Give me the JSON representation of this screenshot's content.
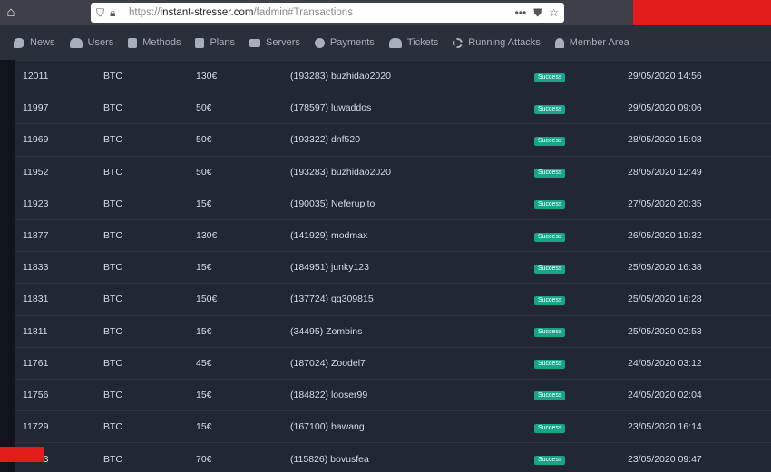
{
  "browser": {
    "url_prefix": "https://",
    "url_host": "instant-stresser.com",
    "url_path": "/fadmin#Transactions"
  },
  "nav": [
    {
      "label": "News",
      "icon": "speech-bubble-icon"
    },
    {
      "label": "Users",
      "icon": "users-icon"
    },
    {
      "label": "Methods",
      "icon": "book-icon"
    },
    {
      "label": "Plans",
      "icon": "book-icon"
    },
    {
      "label": "Servers",
      "icon": "server-list-icon"
    },
    {
      "label": "Payments",
      "icon": "coins-icon"
    },
    {
      "label": "Tickets",
      "icon": "users-icon"
    },
    {
      "label": "Running Attacks",
      "icon": "spinner-icon"
    },
    {
      "label": "Member Area",
      "icon": "person-icon"
    }
  ],
  "transactions": {
    "rows": [
      {
        "id": "12011",
        "currency": "BTC",
        "amount": "130€",
        "user": "(193283) buzhidao2020",
        "status": "Success",
        "date": "29/05/2020 14:56"
      },
      {
        "id": "11997",
        "currency": "BTC",
        "amount": "50€",
        "user": "(178597) luwaddos",
        "status": "Success",
        "date": "29/05/2020 09:06"
      },
      {
        "id": "11969",
        "currency": "BTC",
        "amount": "50€",
        "user": "(193322) dnf520",
        "status": "Success",
        "date": "28/05/2020 15:08"
      },
      {
        "id": "11952",
        "currency": "BTC",
        "amount": "50€",
        "user": "(193283) buzhidao2020",
        "status": "Success",
        "date": "28/05/2020 12:49"
      },
      {
        "id": "11923",
        "currency": "BTC",
        "amount": "15€",
        "user": "(190035) Neferupito",
        "status": "Success",
        "date": "27/05/2020 20:35"
      },
      {
        "id": "11877",
        "currency": "BTC",
        "amount": "130€",
        "user": "(141929) modmax",
        "status": "Success",
        "date": "26/05/2020 19:32"
      },
      {
        "id": "11833",
        "currency": "BTC",
        "amount": "15€",
        "user": "(184951) junky123",
        "status": "Success",
        "date": "25/05/2020 16:38"
      },
      {
        "id": "11831",
        "currency": "BTC",
        "amount": "150€",
        "user": "(137724) qq309815",
        "status": "Success",
        "date": "25/05/2020 16:28"
      },
      {
        "id": "11811",
        "currency": "BTC",
        "amount": "15€",
        "user": "(34495) Zombins",
        "status": "Success",
        "date": "25/05/2020 02:53"
      },
      {
        "id": "11761",
        "currency": "BTC",
        "amount": "45€",
        "user": "(187024) Zoodel7",
        "status": "Success",
        "date": "24/05/2020 03:12"
      },
      {
        "id": "11756",
        "currency": "BTC",
        "amount": "15€",
        "user": "(184822) looser99",
        "status": "Success",
        "date": "24/05/2020 02:04"
      },
      {
        "id": "11729",
        "currency": "BTC",
        "amount": "15€",
        "user": "(167100) bawang",
        "status": "Success",
        "date": "23/05/2020 16:14"
      },
      {
        "id": "11713",
        "currency": "BTC",
        "amount": "70€",
        "user": "(115826) bovusfea",
        "status": "Success",
        "date": "23/05/2020 09:47"
      }
    ]
  },
  "colors": {
    "background": "#222734",
    "navbar": "#2a2f3a",
    "success_badge": "#17a589",
    "redaction": "#e21b1b"
  }
}
